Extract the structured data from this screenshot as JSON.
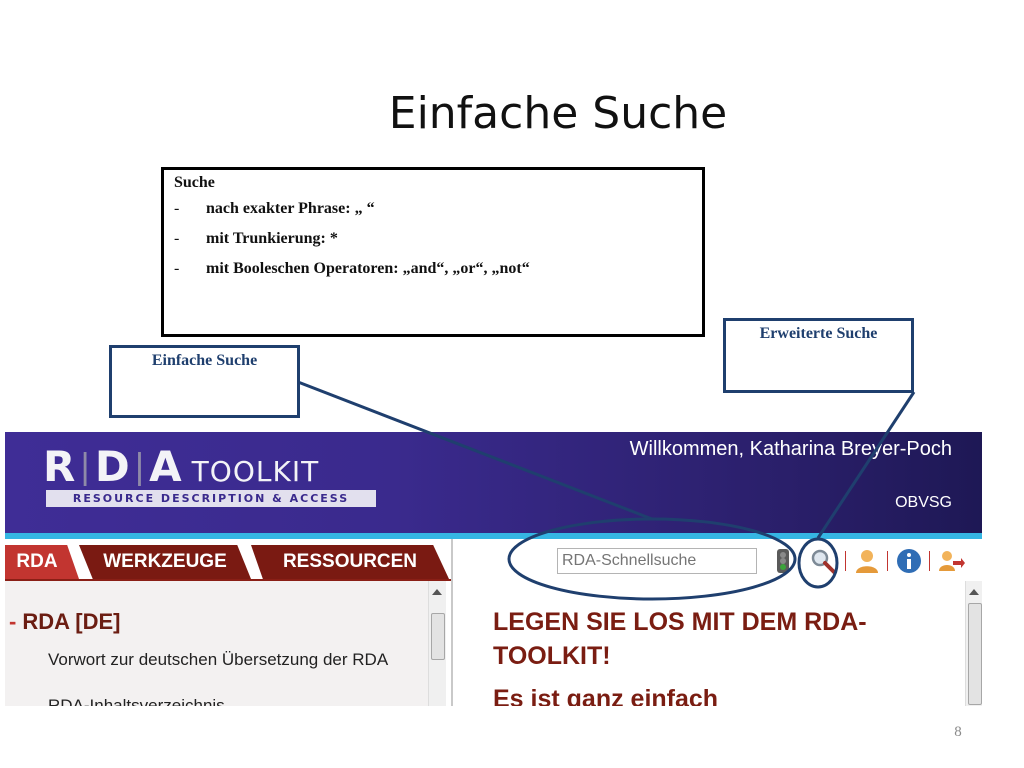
{
  "slide": {
    "title": "Einfache Suche",
    "page_number": "8"
  },
  "info_box": {
    "heading": "Suche",
    "bullets": [
      "nach exakter Phrase: „ “",
      "mit Trunkierung: *",
      "mit Booleschen Operatoren: „and“, „or“, „not“"
    ],
    "bullet_marker": "-"
  },
  "callouts": {
    "simple": "Einfache Suche",
    "advanced": "Erweiterte Suche"
  },
  "rda": {
    "logo": {
      "r": "R",
      "d": "D",
      "a": "A",
      "sep": "|",
      "toolkit": "TOOLKIT",
      "subtitle": "RESOURCE DESCRIPTION & ACCESS"
    },
    "welcome": "Willkommen, Katharina Breyer-Poch",
    "organization": "OBVSG",
    "tabs": [
      "RDA",
      "WERKZEUGE",
      "RESSOURCEN"
    ],
    "search": {
      "placeholder": "RDA-Schnellsuche"
    },
    "icons": [
      "traffic-light-icon",
      "magnifier-icon",
      "user-icon",
      "info-icon",
      "logout-icon"
    ],
    "toc": {
      "minus": "-",
      "heading": "RDA [DE]",
      "items": [
        "Vorwort zur deutschen Übersetzung der RDA",
        "RDA-Inhaltsverzeichnis"
      ]
    },
    "main": {
      "heading": "LEGEN SIE LOS MIT DEM RDA-TOOLKIT!",
      "subheading": "Es ist ganz einfach"
    },
    "colors": {
      "header": "#3a2a8d",
      "accent": "#35b6e3",
      "tab_active": "#c23530",
      "tab": "#7a1a12",
      "heading": "#7a1d12"
    }
  },
  "annotation_color": "#1f3f6e"
}
